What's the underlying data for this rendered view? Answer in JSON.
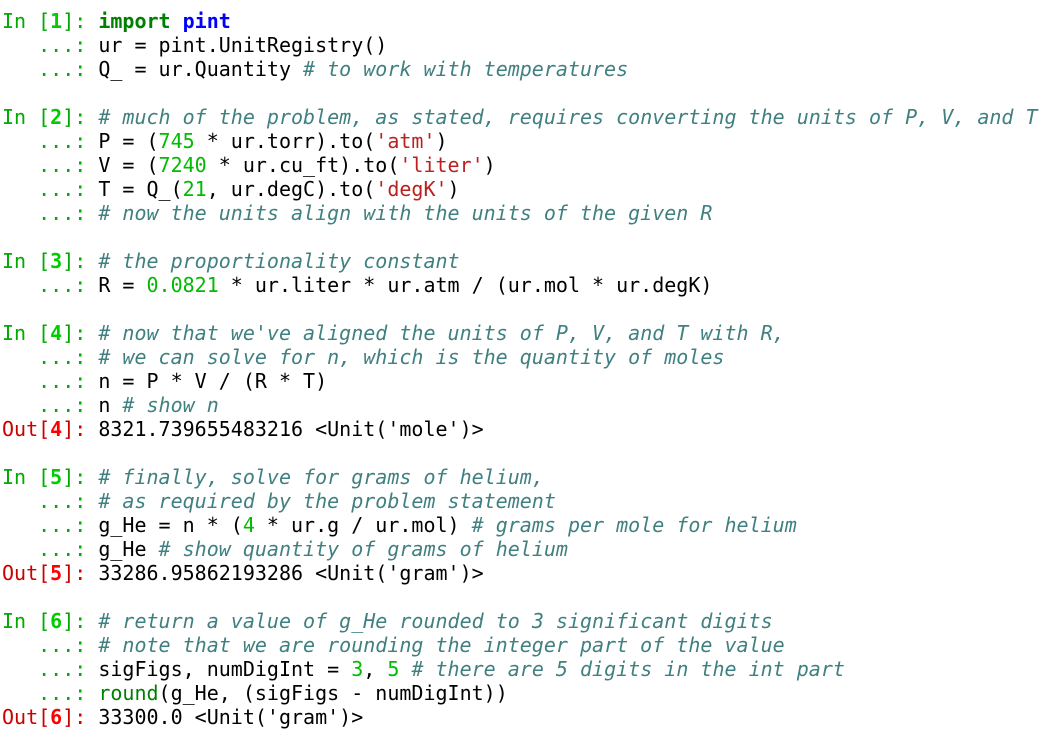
{
  "cells": [
    {
      "type": "input",
      "number": "1",
      "lines": [
        [
          {
            "t": "kw",
            "v": "import"
          },
          {
            "t": "tx",
            "v": " "
          },
          {
            "t": "mod",
            "v": "pint"
          }
        ],
        [
          {
            "t": "tx",
            "v": "ur = pint.UnitRegistry()"
          }
        ],
        [
          {
            "t": "tx",
            "v": "Q_ = ur.Quantity "
          },
          {
            "t": "cm",
            "v": "# to work with temperatures"
          }
        ]
      ]
    },
    {
      "type": "input",
      "number": "2",
      "lines": [
        [
          {
            "t": "cm",
            "v": "# much of the problem, as stated, requires converting the units of P, V, and T"
          }
        ],
        [
          {
            "t": "tx",
            "v": "P = ("
          },
          {
            "t": "num",
            "v": "745"
          },
          {
            "t": "tx",
            "v": " * ur.torr).to("
          },
          {
            "t": "str",
            "v": "'atm'"
          },
          {
            "t": "tx",
            "v": ")"
          }
        ],
        [
          {
            "t": "tx",
            "v": "V = ("
          },
          {
            "t": "num",
            "v": "7240"
          },
          {
            "t": "tx",
            "v": " * ur.cu_ft).to("
          },
          {
            "t": "str",
            "v": "'liter'"
          },
          {
            "t": "tx",
            "v": ")"
          }
        ],
        [
          {
            "t": "tx",
            "v": "T = Q_("
          },
          {
            "t": "num",
            "v": "21"
          },
          {
            "t": "tx",
            "v": ", ur.degC).to("
          },
          {
            "t": "str",
            "v": "'degK'"
          },
          {
            "t": "tx",
            "v": ")"
          }
        ],
        [
          {
            "t": "cm",
            "v": "# now the units align with the units of the given R"
          }
        ]
      ]
    },
    {
      "type": "input",
      "number": "3",
      "lines": [
        [
          {
            "t": "cm",
            "v": "# the proportionality constant"
          }
        ],
        [
          {
            "t": "tx",
            "v": "R = "
          },
          {
            "t": "num",
            "v": "0.0821"
          },
          {
            "t": "tx",
            "v": " * ur.liter * ur.atm / (ur.mol * ur.degK)"
          }
        ]
      ]
    },
    {
      "type": "input",
      "number": "4",
      "lines": [
        [
          {
            "t": "cm",
            "v": "# now that we've aligned the units of P, V, and T with R,"
          }
        ],
        [
          {
            "t": "cm",
            "v": "# we can solve for n, which is the quantity of moles"
          }
        ],
        [
          {
            "t": "tx",
            "v": "n = P * V / (R * T)"
          }
        ],
        [
          {
            "t": "tx",
            "v": "n "
          },
          {
            "t": "cm",
            "v": "# show n"
          }
        ]
      ],
      "output": "8321.739655483216 <Unit('mole')>"
    },
    {
      "type": "input",
      "number": "5",
      "lines": [
        [
          {
            "t": "cm",
            "v": "# finally, solve for grams of helium,"
          }
        ],
        [
          {
            "t": "cm",
            "v": "# as required by the problem statement"
          }
        ],
        [
          {
            "t": "tx",
            "v": "g_He = n * ("
          },
          {
            "t": "num",
            "v": "4"
          },
          {
            "t": "tx",
            "v": " * ur.g / ur.mol) "
          },
          {
            "t": "cm",
            "v": "# grams per mole for helium"
          }
        ],
        [
          {
            "t": "tx",
            "v": "g_He "
          },
          {
            "t": "cm",
            "v": "# show quantity of grams of helium"
          }
        ]
      ],
      "output": "33286.95862193286 <Unit('gram')>"
    },
    {
      "type": "input",
      "number": "6",
      "lines": [
        [
          {
            "t": "cm",
            "v": "# return a value of g_He rounded to 3 significant digits"
          }
        ],
        [
          {
            "t": "cm",
            "v": "# note that we are rounding the integer part of the value"
          }
        ],
        [
          {
            "t": "tx",
            "v": "sigFigs, numDigInt = "
          },
          {
            "t": "num",
            "v": "3"
          },
          {
            "t": "tx",
            "v": ", "
          },
          {
            "t": "num",
            "v": "5"
          },
          {
            "t": "tx",
            "v": " "
          },
          {
            "t": "cm",
            "v": "# there are 5 digits in the int part"
          }
        ],
        [
          {
            "t": "bi",
            "v": "round"
          },
          {
            "t": "tx",
            "v": "(g_He, (sigFigs - numDigInt))"
          }
        ]
      ],
      "output": "33300.0 <Unit('gram')>"
    }
  ],
  "prompts": {
    "in_prefix": "In [",
    "in_suffix": "]: ",
    "out_prefix": "Out[",
    "out_suffix": "]: ",
    "continuation": "   ...: "
  },
  "colors": {
    "prompt_in": "#00aa00",
    "prompt_out": "#cc0000",
    "comment": "#408080",
    "number": "#00bb00",
    "string": "#ba2121",
    "keyword": "#008000",
    "module": "#0000ff"
  }
}
